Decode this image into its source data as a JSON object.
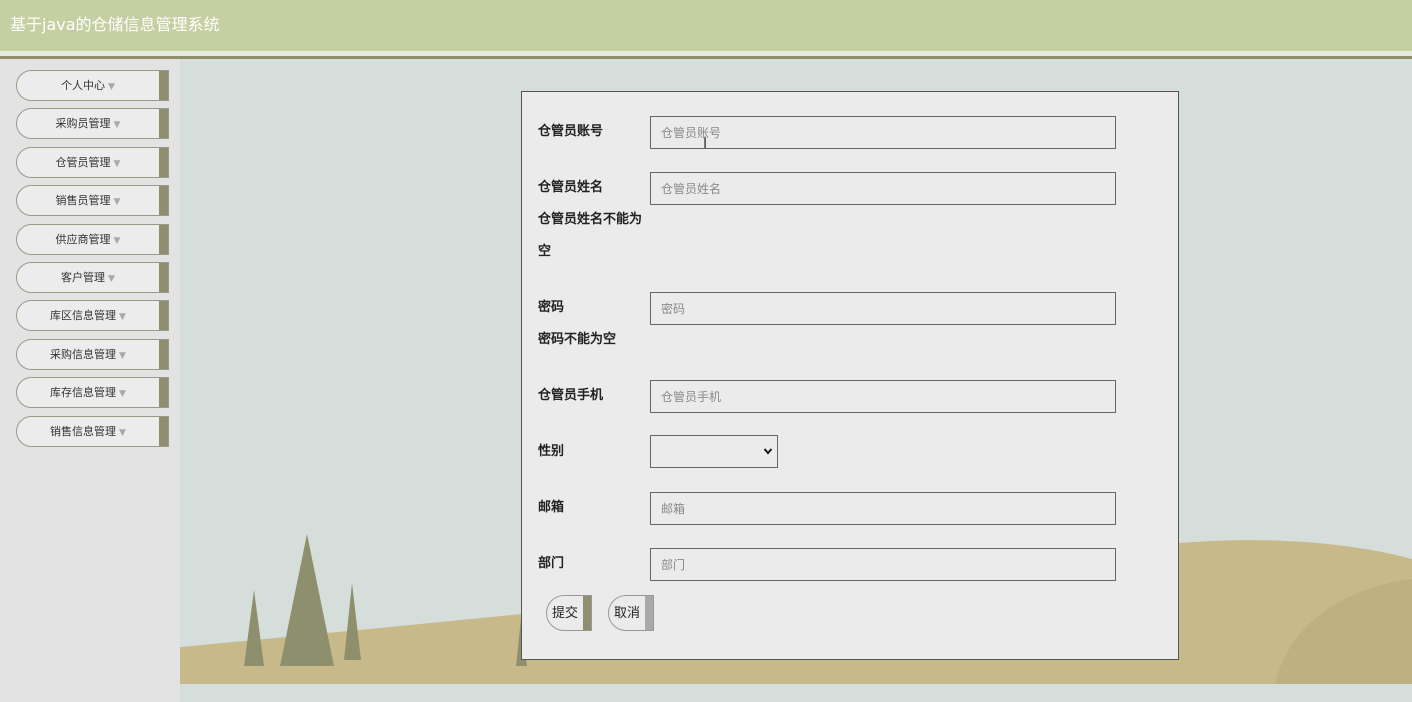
{
  "header": {
    "title": "基于java的仓储信息管理系统"
  },
  "sidebar": {
    "items": [
      {
        "label": "个人中心"
      },
      {
        "label": "采购员管理"
      },
      {
        "label": "仓管员管理"
      },
      {
        "label": "销售员管理"
      },
      {
        "label": "供应商管理"
      },
      {
        "label": "客户管理"
      },
      {
        "label": "库区信息管理"
      },
      {
        "label": "采购信息管理"
      },
      {
        "label": "库存信息管理"
      },
      {
        "label": "销售信息管理"
      }
    ],
    "caret": "▼"
  },
  "form": {
    "fields": [
      {
        "label": "仓管员账号",
        "value": "",
        "placeholder": "仓管员账号"
      },
      {
        "label": "仓管员姓名",
        "value": "",
        "placeholder": "仓管员姓名",
        "error_line1": "仓管员姓名不能为",
        "error_line2": "空"
      },
      {
        "label": "密码",
        "value": "",
        "placeholder": "密码",
        "error": "密码不能为空"
      },
      {
        "label": "仓管员手机",
        "value": "",
        "placeholder": "仓管员手机"
      },
      {
        "label": "性别",
        "value": ""
      },
      {
        "label": "邮箱",
        "value": "",
        "placeholder": "邮箱"
      },
      {
        "label": "部门",
        "value": "",
        "placeholder": "部门"
      }
    ],
    "submit_label": "提交",
    "cancel_label": "取消"
  },
  "colors": {
    "header_bg": "#c5cfa2",
    "accent_olive": "#8f8f6f",
    "cancel_bar": "#a9a9a9",
    "hill": "#c8b98a",
    "tree": "#8e8f6d"
  }
}
